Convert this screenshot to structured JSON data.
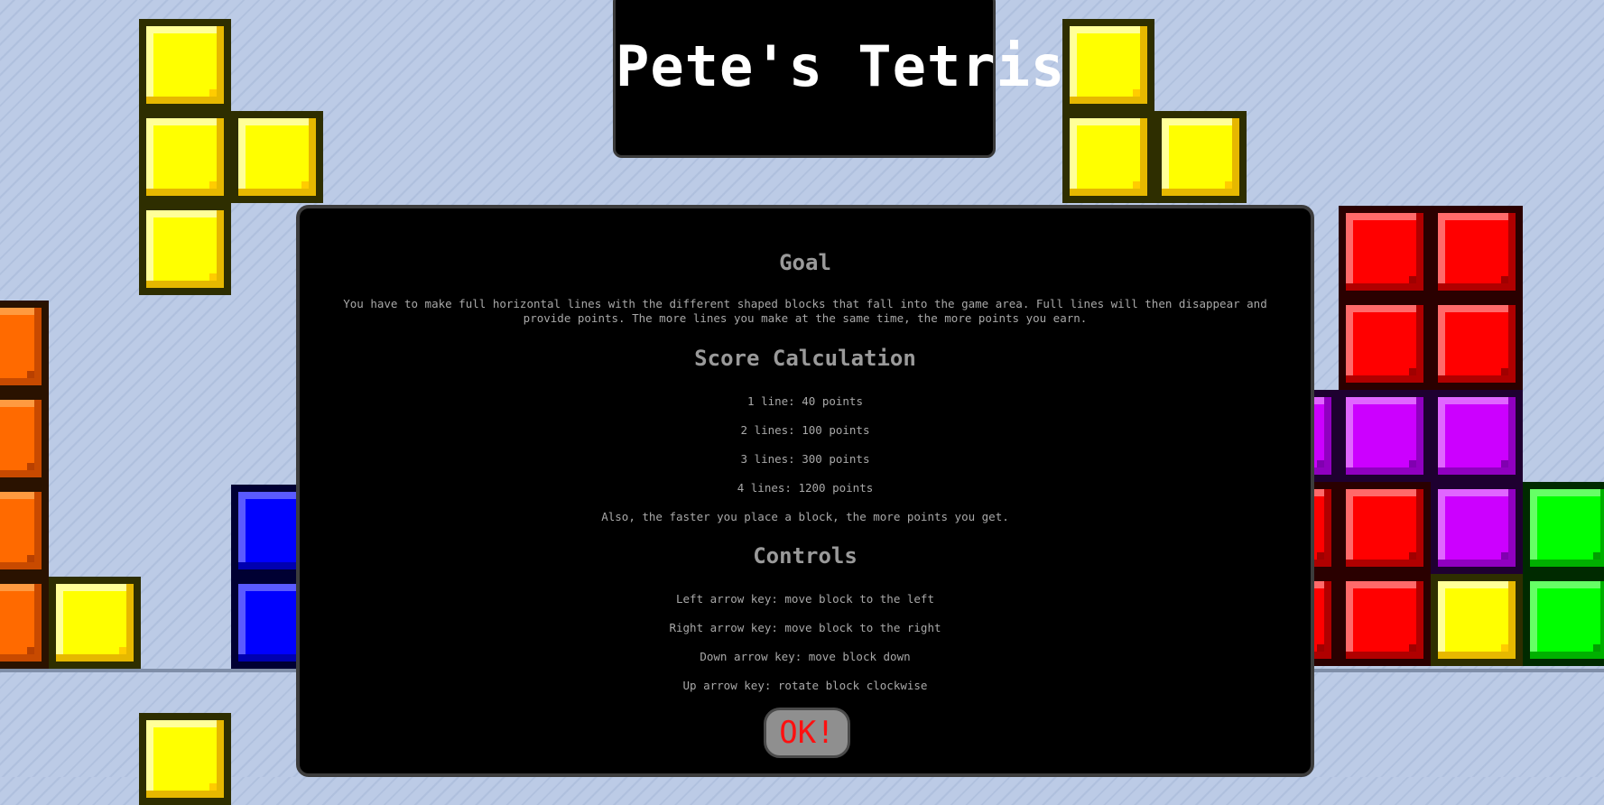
{
  "title": "Pete's Tetris",
  "dialog": {
    "goal_heading": "Goal",
    "goal_text": "You have to make full horizontal lines with the different shaped blocks that fall into the game area. Full lines will then disappear and provide points. The more lines you make at the same time, the more points you earn.",
    "score_heading": "Score Calculation",
    "score_lines": [
      "1 line: 40 points",
      "2 lines: 100 points",
      "3 lines: 300 points",
      "4 lines: 1200 points"
    ],
    "score_note": "Also, the faster you place a block, the more points you get.",
    "controls_heading": "Controls",
    "controls": [
      "Left arrow key: move block to the left",
      "Right arrow key: move block to the right",
      "Down arrow key: move block down",
      "Up arrow key: rotate block clockwise"
    ],
    "ok_label": "OK!"
  },
  "colors": {
    "yellow": "#ffff00",
    "orange": "#ff6a00",
    "blue": "#0000ff",
    "red": "#ff0000",
    "purple": "#cc00ff",
    "green": "#00ff00"
  }
}
